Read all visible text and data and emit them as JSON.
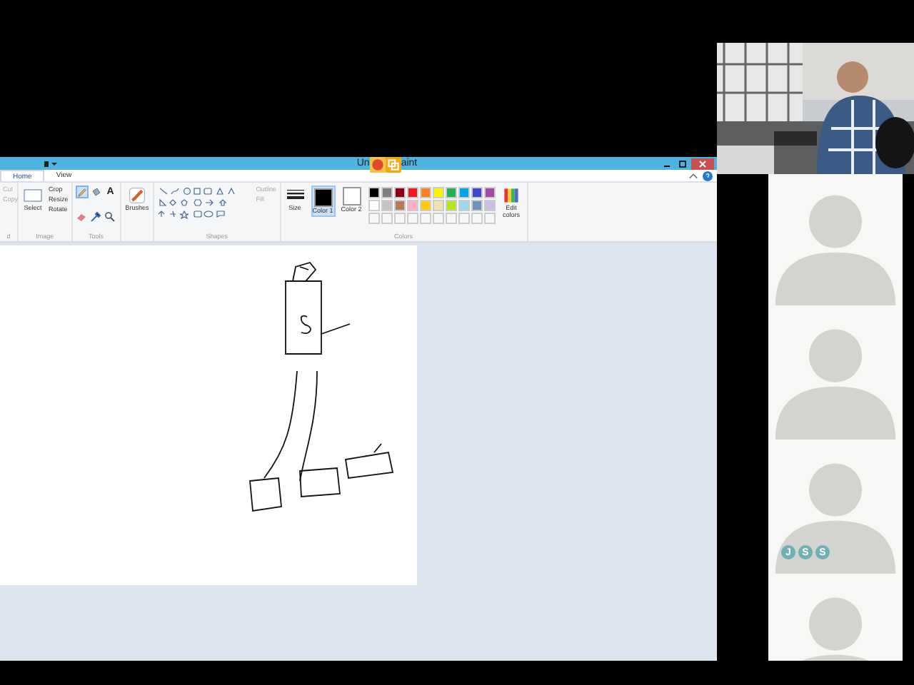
{
  "paint_window": {
    "title_parts": [
      "Un",
      "aint"
    ],
    "tabs": [
      {
        "label": "Home",
        "selected": true
      },
      {
        "label": "View",
        "selected": false
      }
    ],
    "clipboard": {
      "items": [
        "Cut",
        "Copy"
      ],
      "label": "d"
    },
    "image": {
      "select": "Select",
      "items": [
        "Crop",
        "Resize",
        "Rotate"
      ],
      "label": "Image"
    },
    "tools": {
      "items": [
        {
          "kind": "pencil",
          "selected": true
        },
        {
          "kind": "fill",
          "selected": false
        },
        {
          "kind": "text",
          "glyph": "A",
          "selected": false
        },
        {
          "kind": "eraser",
          "selected": false
        },
        {
          "kind": "picker",
          "selected": false
        },
        {
          "kind": "magnifier",
          "selected": false
        }
      ],
      "label": "Tools"
    },
    "brushes": "Brushes",
    "shapes": {
      "outline": "Outline",
      "fill": "Fill",
      "label": "Shapes"
    },
    "size": "Size",
    "color_1": {
      "label": "Color 1",
      "color": "#000000",
      "selected": true
    },
    "color_2": {
      "label": "Color 2",
      "color": "#ffffff",
      "selected": false
    },
    "palette": [
      {
        "kind": "color",
        "color": "#000000"
      },
      {
        "kind": "color",
        "color": "#7f7f7f"
      },
      {
        "kind": "color",
        "color": "#880015"
      },
      {
        "kind": "color",
        "color": "#ed1c24"
      },
      {
        "kind": "color",
        "color": "#ff7f27"
      },
      {
        "kind": "color",
        "color": "#fff200"
      },
      {
        "kind": "color",
        "color": "#22b14c"
      },
      {
        "kind": "color",
        "color": "#00a2e8"
      },
      {
        "kind": "color",
        "color": "#3f48cc"
      },
      {
        "kind": "color",
        "color": "#a349a4"
      },
      {
        "kind": "color",
        "color": "#ffffff"
      },
      {
        "kind": "color",
        "color": "#c3c3c3"
      },
      {
        "kind": "color",
        "color": "#b97a57"
      },
      {
        "kind": "color",
        "color": "#ffaec9"
      },
      {
        "kind": "color",
        "color": "#ffc90e"
      },
      {
        "kind": "color",
        "color": "#efe4b0"
      },
      {
        "kind": "color",
        "color": "#b5e61d"
      },
      {
        "kind": "color",
        "color": "#99d9ea"
      },
      {
        "kind": "color",
        "color": "#7092be"
      },
      {
        "kind": "color",
        "color": "#c8bfe7"
      },
      {
        "kind": "empty"
      },
      {
        "kind": "empty"
      },
      {
        "kind": "empty"
      },
      {
        "kind": "empty"
      },
      {
        "kind": "empty"
      },
      {
        "kind": "empty"
      },
      {
        "kind": "empty"
      },
      {
        "kind": "empty"
      },
      {
        "kind": "empty"
      },
      {
        "kind": "empty"
      }
    ],
    "edit_colors": "Edit colors",
    "colors_label": "Colors"
  },
  "participants": [
    {
      "kind": "silhouette"
    },
    {
      "kind": "silhouette"
    },
    {
      "kind": "silhouette",
      "initials": [
        "J",
        "S",
        "S"
      ]
    },
    {
      "kind": "silhouette"
    }
  ]
}
